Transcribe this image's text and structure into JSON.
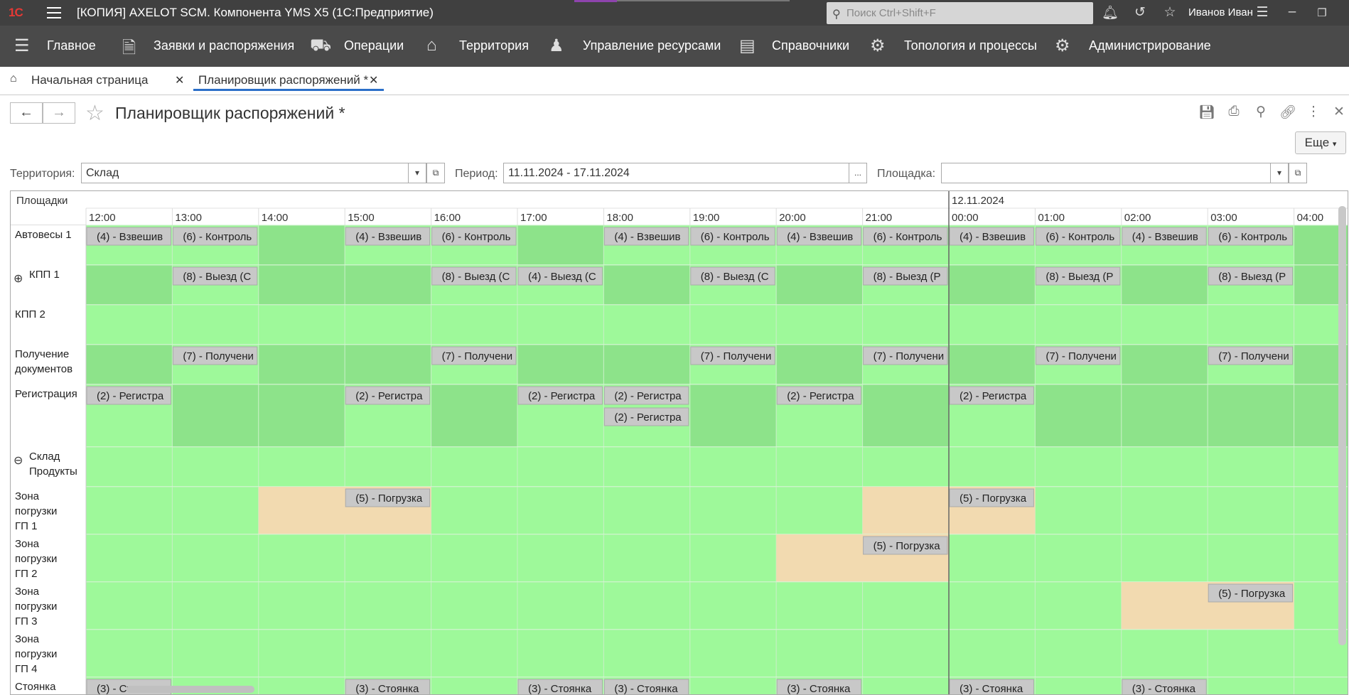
{
  "titlebar": {
    "logo": "1С",
    "title": "[КОПИЯ] AXELOT SCM. Компонента YMS X5  (1С:Предприятие)",
    "search_placeholder": "Поиск Ctrl+Shift+F",
    "user": "Иванов Иван"
  },
  "nav": {
    "items": [
      {
        "label": "Главное",
        "icon": "hamburger-icon"
      },
      {
        "label": "Заявки и распоряжения",
        "icon": "document-icon"
      },
      {
        "label": "Операции",
        "icon": "truck-icon"
      },
      {
        "label": "Территория",
        "icon": "warehouse-icon"
      },
      {
        "label": "Управление ресурсами",
        "icon": "people-icon"
      },
      {
        "label": "Справочники",
        "icon": "books-icon"
      },
      {
        "label": "Топология и процессы",
        "icon": "topology-icon"
      },
      {
        "label": "Администрирование",
        "icon": "gears-icon"
      }
    ]
  },
  "tabs": [
    {
      "label": "Начальная страница"
    },
    {
      "label": "Планировщик распоряжений *"
    }
  ],
  "page": {
    "title": "Планировщик распоряжений *",
    "more_label": "Еще"
  },
  "filters": {
    "territory_label": "Территория:",
    "territory_value": "Склад",
    "period_label": "Период:",
    "period_value": "11.11.2024 - 17.11.2024",
    "period_btn": "...",
    "area_label": "Площадка:",
    "area_value": ""
  },
  "grid": {
    "header_label": "Площадки",
    "date_label": "12.11.2024",
    "times": [
      "12:00",
      "13:00",
      "14:00",
      "15:00",
      "16:00",
      "17:00",
      "18:00",
      "19:00",
      "20:00",
      "21:00",
      "00:00",
      "01:00",
      "02:00",
      "03:00",
      "04:00"
    ],
    "rows": [
      {
        "label": "Автовесы 1",
        "events": [
          {
            "col": 0,
            "text": "(4) - Взвешив"
          },
          {
            "col": 1,
            "text": "(6) - Контроль"
          },
          {
            "col": 3,
            "text": "(4) - Взвешив"
          },
          {
            "col": 4,
            "text": "(6) - Контроль"
          },
          {
            "col": 6,
            "text": "(4) - Взвешив"
          },
          {
            "col": 7,
            "text": "(6) - Контроль"
          },
          {
            "col": 8,
            "text": "(4) - Взвешив"
          },
          {
            "col": 9,
            "text": "(6) - Контроль"
          },
          {
            "col": 10,
            "text": "(4) - Взвешив"
          },
          {
            "col": 11,
            "text": "(6) - Контроль"
          },
          {
            "col": 12,
            "text": "(4) - Взвешив"
          },
          {
            "col": 13,
            "text": "(6) - Контроль"
          }
        ]
      },
      {
        "label": "КПП 1",
        "expand": "⊕",
        "events": [
          {
            "col": 1,
            "text": "(8) - Выезд (С"
          },
          {
            "col": 4,
            "text": "(8) - Выезд (С"
          },
          {
            "col": 5,
            "text": "(4) - Выезд (С"
          },
          {
            "col": 7,
            "text": "(8) - Выезд (С"
          },
          {
            "col": 9,
            "text": "(8) - Выезд (Р"
          },
          {
            "col": 11,
            "text": "(8) - Выезд (Р"
          },
          {
            "col": 13,
            "text": "(8) - Выезд (Р"
          }
        ]
      },
      {
        "label": "КПП 2",
        "events": []
      },
      {
        "label": "Получение документов",
        "events": [
          {
            "col": 1,
            "text": "(7) - Получени"
          },
          {
            "col": 4,
            "text": "(7) - Получени"
          },
          {
            "col": 7,
            "text": "(7) - Получени"
          },
          {
            "col": 9,
            "text": "(7) - Получени"
          },
          {
            "col": 11,
            "text": "(7) - Получени"
          },
          {
            "col": 13,
            "text": "(7) - Получени"
          }
        ]
      },
      {
        "label": "Регистрация",
        "events": [
          {
            "col": 0,
            "text": "(2) - Регистра"
          },
          {
            "col": 3,
            "text": "(2) - Регистра"
          },
          {
            "col": 5,
            "text": "(2) - Регистра"
          },
          {
            "col": 6,
            "text": "(2) - Регистра"
          },
          {
            "col": 6,
            "text": "(2) - Регистра",
            "sub": 1
          },
          {
            "col": 8,
            "text": "(2) - Регистра"
          },
          {
            "col": 10,
            "text": "(2) - Регистра"
          }
        ]
      },
      {
        "label": "Склад Продукты",
        "expand": "⊖",
        "events": []
      },
      {
        "label": "Зона погрузки ГП 1",
        "events": [
          {
            "col": 3,
            "text": "(5) - Погрузка"
          },
          {
            "col": 10,
            "text": "(5) - Погрузка"
          }
        ]
      },
      {
        "label": "Зона погрузки ГП 2",
        "events": [
          {
            "col": 9,
            "text": "(5) - Погрузка"
          }
        ]
      },
      {
        "label": "Зона погрузки ГП 3",
        "events": [
          {
            "col": 13,
            "text": "(5) - Погрузка"
          }
        ]
      },
      {
        "label": "Зона погрузки ГП 4",
        "events": []
      },
      {
        "label": "Стоянка",
        "events": [
          {
            "col": 0,
            "text": "(3) - Стоянка"
          },
          {
            "col": 3,
            "text": "(3) - Стоянка"
          },
          {
            "col": 5,
            "text": "(3) - Стоянка"
          },
          {
            "col": 6,
            "text": "(3) - Стоянка"
          },
          {
            "col": 8,
            "text": "(3) - Стоянка"
          },
          {
            "col": 10,
            "text": "(3) - Стоянка"
          },
          {
            "col": 12,
            "text": "(3) - Стоянка"
          }
        ]
      }
    ]
  },
  "colors": {
    "free": "#9ef99a",
    "busy": "#8de38a",
    "loading": "#f2dab0",
    "event": "#c8c8c8"
  }
}
